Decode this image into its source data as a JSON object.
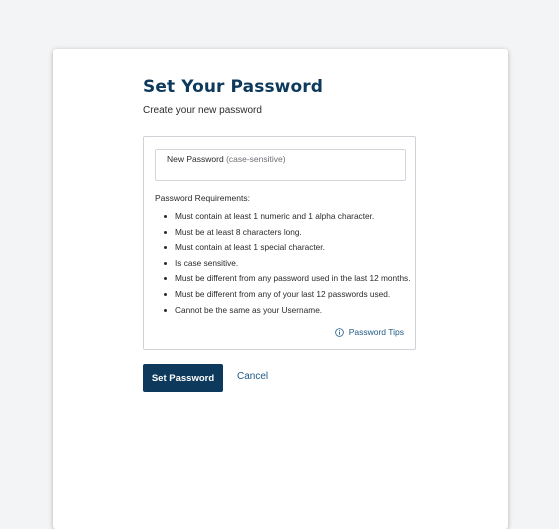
{
  "page": {
    "title": "Set Your Password",
    "subtitle": "Create your new password"
  },
  "password_field": {
    "label": "New Password",
    "hint": "(case-sensitive)"
  },
  "requirements": {
    "title": "Password Requirements:",
    "items": [
      "Must contain at least 1 numeric and 1 alpha character.",
      "Must be at least 8 characters long.",
      "Must contain at least 1 special character.",
      "Is case sensitive.",
      "Must be different from any password used in the last 12 months.",
      "Must be different from any of your last 12 passwords used.",
      "Cannot be the same as your Username."
    ]
  },
  "tips": {
    "label": "Password Tips",
    "icon": "info-icon"
  },
  "actions": {
    "submit_label": "Set Password",
    "cancel_label": "Cancel"
  },
  "colors": {
    "brand_navy": "#0d3a5c",
    "link_blue": "#1f5a86",
    "page_background": "#f3f4f6"
  }
}
